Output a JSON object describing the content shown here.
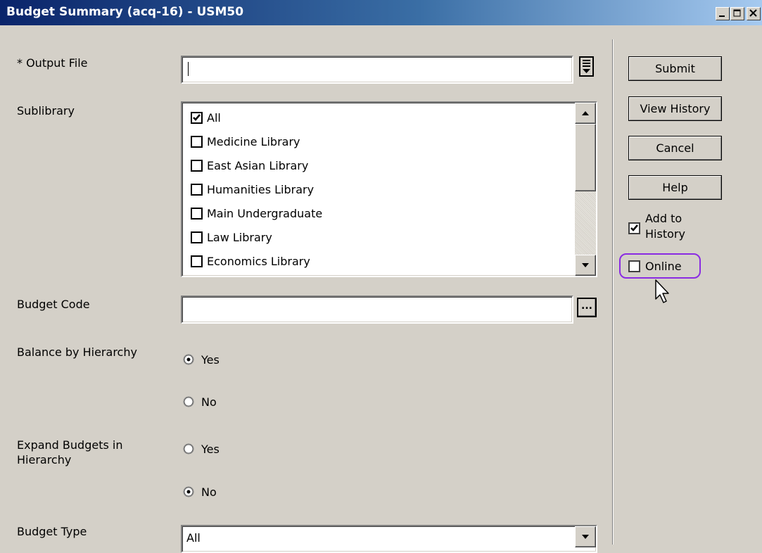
{
  "window": {
    "title": "Budget Summary (acq-16) - USM50",
    "min_icon": "minimize-icon",
    "max_icon": "maximize-icon",
    "close_icon": "close-icon"
  },
  "form": {
    "output_file": {
      "label": "* Output File",
      "value": ""
    },
    "sublibrary": {
      "label": "Sublibrary",
      "items": [
        {
          "label": "All",
          "checked": true
        },
        {
          "label": "Medicine Library",
          "checked": false
        },
        {
          "label": "East Asian Library",
          "checked": false
        },
        {
          "label": "Humanities Library",
          "checked": false
        },
        {
          "label": "Main Undergraduate",
          "checked": false
        },
        {
          "label": "Law Library",
          "checked": false
        },
        {
          "label": "Economics Library",
          "checked": false
        }
      ]
    },
    "budget_code": {
      "label": "Budget Code",
      "value": "",
      "browse_label": "..."
    },
    "balance_by_hierarchy": {
      "label": "Balance by Hierarchy",
      "options": [
        {
          "label": "Yes",
          "selected": true
        },
        {
          "label": "No",
          "selected": false
        }
      ]
    },
    "expand_budgets": {
      "label": "Expand Budgets in Hierarchy",
      "options": [
        {
          "label": "Yes",
          "selected": false
        },
        {
          "label": "No",
          "selected": true
        }
      ]
    },
    "budget_type": {
      "label": "Budget Type",
      "value": "All"
    }
  },
  "side": {
    "submit": "Submit",
    "view_history": "View History",
    "cancel": "Cancel",
    "help": "Help",
    "add_to_history": {
      "label_line1": "Add to",
      "label_line2": "History",
      "checked": true
    },
    "online": {
      "label": "Online",
      "checked": false,
      "highlight_color": "#8a2be2"
    }
  },
  "colors": {
    "title_start": "#0a246a",
    "title_end": "#a6caf0",
    "face": "#d4d0c8"
  }
}
